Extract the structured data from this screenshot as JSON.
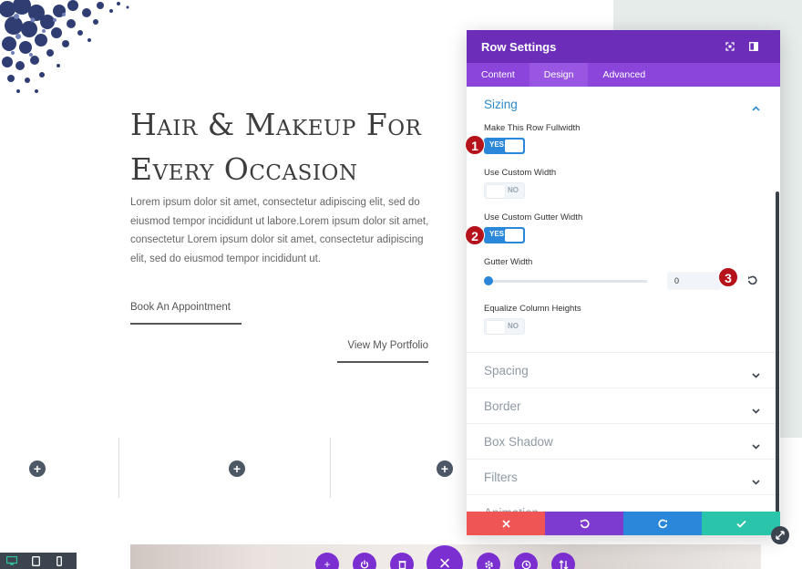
{
  "hero": {
    "title": "Hair & Makeup For Every Occasion",
    "body": "Lorem ipsum dolor sit amet, consectetur adipiscing elit, sed do eiusmod tempor incididunt ut labore.Lorem ipsum dolor sit amet, consectetur Lorem ipsum dolor sit amet, consectetur adipiscing elit, sed do eiusmod tempor incididunt ut.",
    "book_label": "Book An Appointment",
    "portfolio_label": "View My Portfolio"
  },
  "modal": {
    "title": "Row Settings",
    "tabs": [
      {
        "label": "Content",
        "active": false
      },
      {
        "label": "Design",
        "active": true
      },
      {
        "label": "Advanced",
        "active": false
      }
    ],
    "sizing": {
      "title": "Sizing",
      "fullwidth_label": "Make This Row Fullwidth",
      "fullwidth_state": "YES",
      "custom_width_label": "Use Custom Width",
      "custom_width_state": "NO",
      "custom_gutter_label": "Use Custom Gutter Width",
      "custom_gutter_state": "YES",
      "gutter_label": "Gutter Width",
      "gutter_value": "0",
      "equalize_label": "Equalize Column Heights",
      "equalize_state": "NO"
    },
    "sections": [
      "Spacing",
      "Border",
      "Box Shadow",
      "Filters",
      "Animation"
    ]
  },
  "markers": [
    "1",
    "2",
    "3"
  ],
  "colors": {
    "header": "#6c2eb9",
    "tabs": "#8b45da",
    "accent_blue": "#2b87da",
    "cancel": "#ef5555",
    "undo": "#7e3bd0",
    "redo": "#2b87da",
    "save": "#29c4a9",
    "marker": "#b5121b"
  },
  "icons": [
    "expand-icon",
    "sidebar-toggle-icon",
    "chevron-up-icon",
    "chevron-down-icon",
    "reset-icon",
    "close-icon",
    "undo-icon",
    "redo-icon",
    "check-icon",
    "plus-icon",
    "power-icon",
    "trash-icon",
    "gear-icon",
    "history-icon",
    "sort-icon",
    "desktop-icon",
    "tablet-icon",
    "phone-icon",
    "resize-icon"
  ]
}
